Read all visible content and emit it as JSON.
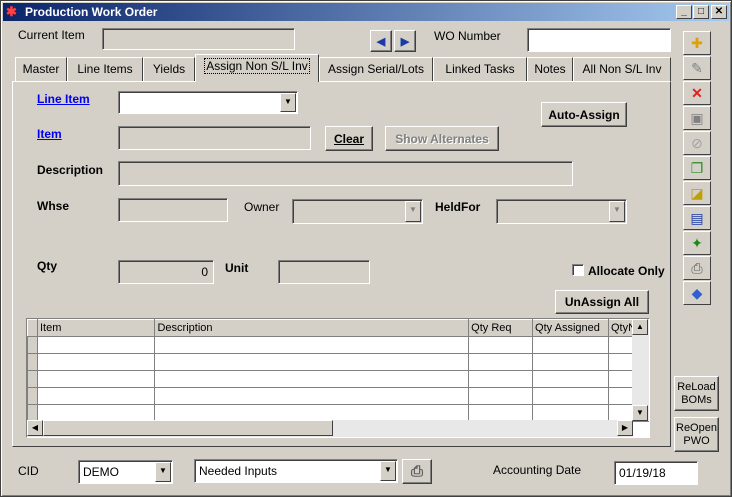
{
  "window": {
    "title": "Production Work Order",
    "minimize": "_",
    "maximize": "□",
    "close": "✕"
  },
  "header": {
    "current_item_label": "Current Item",
    "current_item_value": "",
    "wo_number_label": "WO Number",
    "wo_number_value": "",
    "prev_arrow": "◀",
    "next_arrow": "▶"
  },
  "tabs": [
    {
      "label": "Master"
    },
    {
      "label": "Line Items"
    },
    {
      "label": "Yields"
    },
    {
      "label": "Assign  Non S/L Inv"
    },
    {
      "label": "Assign Serial/Lots"
    },
    {
      "label": "Linked Tasks"
    },
    {
      "label": "Notes"
    },
    {
      "label": "All Non S/L Inv"
    }
  ],
  "form": {
    "line_item_label": "Line Item",
    "line_item_value": "",
    "auto_assign": "Auto-Assign",
    "item_label": "Item",
    "item_value": "",
    "clear": "Clear",
    "show_alternates": "Show Alternates",
    "description_label": "Description",
    "description_value": "",
    "whse_label": "Whse",
    "whse_value": "",
    "owner_label": "Owner",
    "owner_value": "",
    "heldfor_label": "HeldFor",
    "heldfor_value": "",
    "qty_label": "Qty",
    "qty_value": "0",
    "unit_label": "Unit",
    "unit_value": "",
    "allocate_only_label": "Allocate Only",
    "allocate_only_checked": false,
    "unassign_all": "UnAssign All"
  },
  "grid": {
    "columns": [
      "Item",
      "Description",
      "Qty Req",
      "Qty Assigned",
      "QtyN"
    ],
    "rows": [
      [
        "",
        "",
        "",
        "",
        ""
      ],
      [
        "",
        "",
        "",
        "",
        ""
      ],
      [
        "",
        "",
        "",
        "",
        ""
      ],
      [
        "",
        "",
        "",
        "",
        ""
      ],
      [
        "",
        "",
        "",
        "",
        ""
      ]
    ]
  },
  "side_buttons": [
    {
      "icon": "new-icon"
    },
    {
      "icon": "edit-icon"
    },
    {
      "icon": "delete-icon"
    },
    {
      "icon": "save-icon"
    },
    {
      "icon": "cancel-icon"
    },
    {
      "icon": "copy-icon"
    },
    {
      "icon": "note-icon"
    },
    {
      "icon": "card-icon"
    },
    {
      "icon": "pin-icon"
    },
    {
      "icon": "print-icon"
    },
    {
      "icon": "tag-icon"
    }
  ],
  "reload_boms": {
    "line1": "ReLoad",
    "line2": "BOMs"
  },
  "reopen_pwo": {
    "line1": "ReOpen",
    "line2": "PWO"
  },
  "footer": {
    "cid_label": "CID",
    "cid_value": "DEMO",
    "report_value": "Needed Inputs",
    "accounting_date_label": "Accounting Date",
    "accounting_date_value": "01/19/18"
  },
  "colors": {
    "title_start": "#0a246a",
    "title_end": "#a6caf0",
    "link": "#0000ee",
    "face": "#d4d0c8"
  }
}
